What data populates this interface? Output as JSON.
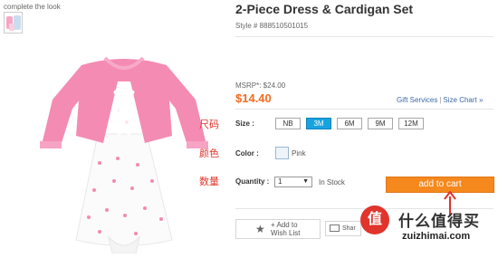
{
  "left": {
    "complete_the_look": "complete the look"
  },
  "product": {
    "title": "2-Piece Dress & Cardigan Set",
    "style": "Style # 888510501015",
    "msrp": "MSRP*: $24.00",
    "price": "$14.40",
    "gift_services": "Gift Services",
    "size_chart": "Size Chart »"
  },
  "size": {
    "label": "Size :",
    "options": [
      "NB",
      "3M",
      "6M",
      "9M",
      "12M"
    ],
    "selected": "3M"
  },
  "color": {
    "label": "Color :",
    "value": "Pink"
  },
  "quantity": {
    "label": "Quantity :",
    "value": "1",
    "stock": "In Stock"
  },
  "cart": {
    "button": "add to cart"
  },
  "wishlist": {
    "line1": "+ Add to",
    "line2": "Wish List"
  },
  "share": {
    "label": "Shar"
  },
  "annotations": {
    "size_cn": "尺码",
    "color_cn": "颜色",
    "qty_cn": "数量"
  },
  "watermark": {
    "badge": "值",
    "title": "什么值得买",
    "url": "zuizhimai.com"
  },
  "colors": {
    "price": "#f36b20",
    "selected_size": "#18a3e0",
    "cart_button": "#f5891e",
    "annotation": "#e0342c"
  }
}
